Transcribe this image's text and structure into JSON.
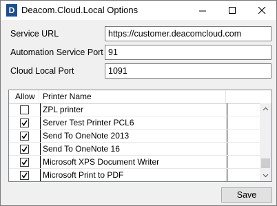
{
  "window": {
    "title": "Deacom.Cloud.Local Options",
    "icon_letter": "D",
    "icon_color": "#1f4f8b"
  },
  "form": {
    "service_url_label": "Service URL",
    "service_url_value": "https://customer.deacomcloud.com",
    "automation_port_label": "Automation Service Port",
    "automation_port_value": "91",
    "cloud_port_label": "Cloud Local Port",
    "cloud_port_value": "1091"
  },
  "grid": {
    "columns": {
      "allow": "Allow",
      "printer_name": "Printer Name"
    },
    "rows": [
      {
        "allow": false,
        "name": "ZPL printer"
      },
      {
        "allow": true,
        "name": "Server Test Printer PCL6"
      },
      {
        "allow": true,
        "name": "Send To OneNote 2013"
      },
      {
        "allow": true,
        "name": "Send To OneNote 16"
      },
      {
        "allow": true,
        "name": "Microsoft XPS Document Writer"
      },
      {
        "allow": true,
        "name": "Microsoft Print to PDF"
      }
    ]
  },
  "buttons": {
    "save": "Save"
  },
  "icons": {
    "minimize": "minimize-icon",
    "maximize": "maximize-icon",
    "close": "close-icon",
    "scroll_up": "chevron-up-icon",
    "scroll_down": "chevron-down-icon",
    "checkbox": "check-icon"
  }
}
